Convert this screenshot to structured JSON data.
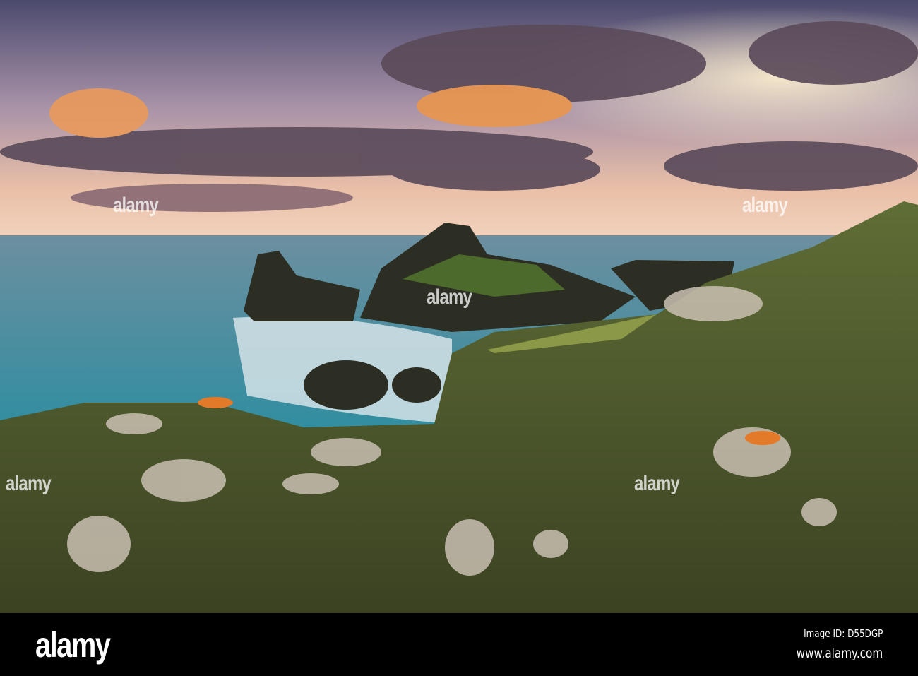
{
  "watermark": "alamy",
  "footer": {
    "logo": "alamy",
    "image_id": "Image ID: D55DGP",
    "url": "www.alamy.com"
  },
  "colors": {
    "sky_top": "#4a4a6e",
    "sky_glow": "#f3c9a8",
    "sea": "#3f8fa0",
    "grass": "#5a6a2e",
    "bar": "#000000"
  }
}
